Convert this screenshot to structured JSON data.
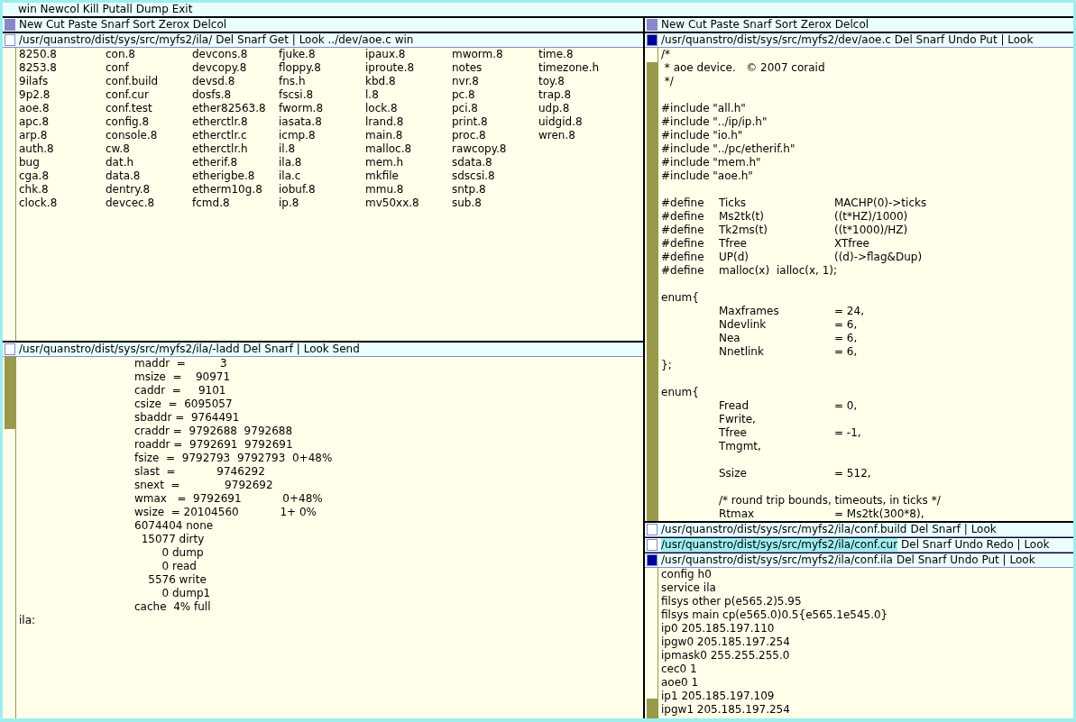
{
  "tag": "win Newcol Kill Putall Dump Exit",
  "columns": [
    {
      "tag": "New Cut Paste Snarf Sort Zerox Delcol",
      "windows": [
        {
          "kind": "directory",
          "path": "/usr/quanstro/dist/sys/src/myfs2/ila/",
          "commands": "Del Snarf Get | Look ../dev/aoe.c win",
          "modified": false,
          "path_selected": false,
          "files": [
            "8250.8",
            "8253.8",
            "9ilafs",
            "9p2.8",
            "aoe.8",
            "apc.8",
            "arp.8",
            "auth.8",
            "bug",
            "cga.8",
            "chk.8",
            "clock.8",
            "con.8",
            "conf",
            "conf.build",
            "conf.cur",
            "conf.test",
            "config.8",
            "console.8",
            "cw.8",
            "dat.h",
            "data.8",
            "dentry.8",
            "devcec.8",
            "devcons.8",
            "devcopy.8",
            "devsd.8",
            "dosfs.8",
            "ether82563.8",
            "etherctlr.8",
            "etherctlr.c",
            "etherctlr.h",
            "etherif.8",
            "etherigbe.8",
            "etherm10g.8",
            "fcmd.8",
            "fjuke.8",
            "floppy.8",
            "fns.h",
            "fscsi.8",
            "fworm.8",
            "iasata.8",
            "icmp.8",
            "il.8",
            "ila.8",
            "ila.c",
            "iobuf.8",
            "ip.8",
            "ipaux.8",
            "iproute.8",
            "kbd.8",
            "l.8",
            "lock.8",
            "lrand.8",
            "main.8",
            "malloc.8",
            "mem.h",
            "mkfile",
            "mmu.8",
            "mv50xx.8",
            "mworm.8",
            "notes",
            "nvr.8",
            "pc.8",
            "pci.8",
            "print.8",
            "proc.8",
            "rawcopy.8",
            "sdata.8",
            "sdscsi.8",
            "sntp.8",
            "sub.8",
            "time.8",
            "timezone.h",
            "toy.8",
            "trap.8",
            "udp.8",
            "uidgid.8",
            "wren.8"
          ]
        },
        {
          "kind": "text",
          "path": "/usr/quanstro/dist/sys/src/myfs2/ila/-ladd",
          "commands": "Del Snarf | Look Send",
          "modified": false,
          "path_selected": false,
          "text": "\t\t\t\tmaddr  =          3\n\t\t\t\tmsize  =    90971\n\t\t\t\tcaddr  =     9101\n\t\t\t\tcsize  =  6095057\n\t\t\t\tsbaddr =  9764491\n\t\t\t\tcraddr =  9792688  9792688\n\t\t\t\troaddr =  9792691  9792691\n\t\t\t\tfsize  =  9792793  9792793  0+48%\n\t\t\t\tslast  =            9746292\n\t\t\t\tsnext  =             9792692\n\t\t\t\twmax   =  9792691            0+48%\n\t\t\t\twsize  = 20104560            1+ 0%\n\t\t\t\t6074404 none\n\t\t\t\t  15077 dirty\n\t\t\t\t        0 dump\n\t\t\t\t        0 read\n\t\t\t\t    5576 write\n\t\t\t\t        0 dump1\n\t\t\t\tcache  4% full\nila: "
        }
      ]
    },
    {
      "tag": "New Cut Paste Snarf Sort Zerox Delcol",
      "windows": [
        {
          "kind": "text",
          "path": "/usr/quanstro/dist/sys/src/myfs2/dev/aoe.c",
          "commands": "Del Snarf Undo Put | Look",
          "modified": true,
          "path_selected": false,
          "text": "/*\n * aoe device.   © 2007 coraid\n */\n\n#include \"all.h\"\n#include \"../ip/ip.h\"\n#include \"io.h\"\n#include \"../pc/etherif.h\"\n#include \"mem.h\"\n#include \"aoe.h\"\n\n#define\tTicks\t\t\tMACHP(0)->ticks\n#define\tMs2tk(t)\t\t\t((t*HZ)/1000)\n#define\tTk2ms(t)\t\t\t((t*1000)/HZ)\n#define\tTfree\t\t\tXTfree\n#define\tUP(d)\t\t\t((d)->flag&Dup)\n#define\tmalloc(x)\tialloc(x, 1);\n\nenum{\n\t\tMaxframes\t\t= 24,\n\t\tNdevlink\t\t\t= 6,\n\t\tNea\t\t\t\t= 6,\n\t\tNnetlink\t\t\t= 6,\n};\n\nenum{\n\t\tFread\t\t\t= 0,\n\t\tFwrite,\n\t\tTfree\t\t\t= -1,\n\t\tTmgmt,\n\n\t\tSsize\t\t\t= 512,\n\n\t\t/* round trip bounds, timeouts, in ticks */\n\t\tRtmax\t\t\t= Ms2tk(300*8),"
        },
        {
          "kind": "tag-only",
          "path": "/usr/quanstro/dist/sys/src/myfs2/ila/conf.build",
          "commands": "Del Snarf | Look",
          "modified": false,
          "path_selected": false
        },
        {
          "kind": "tag-only",
          "path": "/usr/quanstro/dist/sys/src/myfs2/ila/conf.cur",
          "commands": "Del Snarf Undo Redo | Look",
          "modified": false,
          "path_selected": true
        },
        {
          "kind": "text",
          "path": "/usr/quanstro/dist/sys/src/myfs2/ila/conf.ila",
          "commands": "Del Snarf Undo Put | Look",
          "modified": true,
          "path_selected": false,
          "text": "config h0\nservice ila\nfilsys other p(e565.2)5.95\nfilsys main cp(e565.0)0.5{e565.1e545.0}\nip0 205.185.197.110\nipgw0 205.185.197.254\nipmask0 255.255.255.0\ncec0 1\naoe0 1\nip1 205.185.197.109\nipgw1 205.185.197.254"
        }
      ]
    }
  ]
}
